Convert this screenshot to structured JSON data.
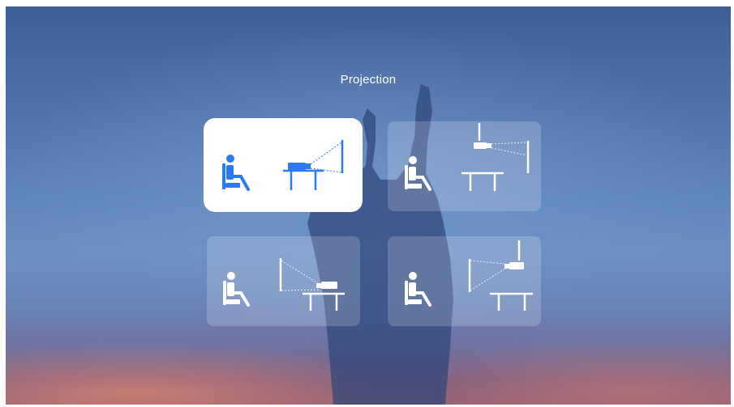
{
  "header": {
    "title": "Projection"
  },
  "projection_modes": [
    {
      "id": "front-table",
      "selected": true
    },
    {
      "id": "front-ceiling",
      "selected": false
    },
    {
      "id": "rear-table",
      "selected": false
    },
    {
      "id": "rear-ceiling",
      "selected": false
    }
  ],
  "colors": {
    "accent": "#2a7bf0",
    "card_idle_icon": "#ffffff",
    "selected_card_bg": "#ffffff"
  },
  "icons": [
    "person-seated-icon",
    "projector-icon",
    "table-icon",
    "projection-screen-icon",
    "ceiling-mount-icon"
  ]
}
